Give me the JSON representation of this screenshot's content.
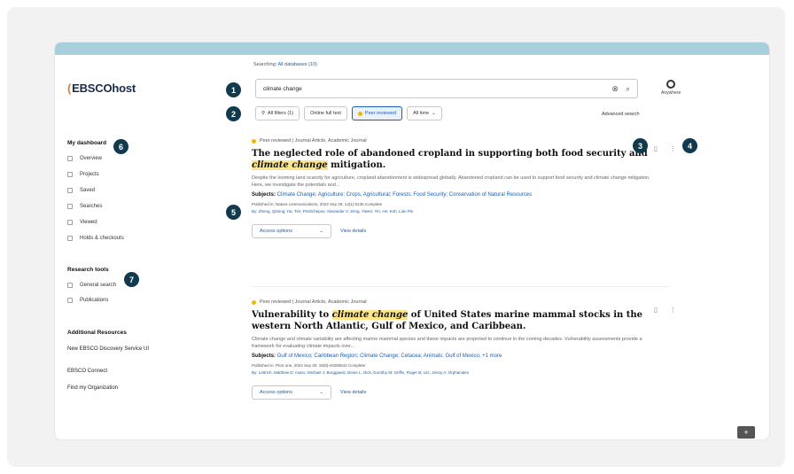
{
  "logo": {
    "text": "EBSCOhost",
    "mark": "("
  },
  "sidebar": {
    "dashboard_title": "My dashboard",
    "dashboard_items": [
      {
        "label": "Overview",
        "icon": "overview-icon"
      },
      {
        "label": "Projects",
        "icon": "projects-icon"
      },
      {
        "label": "Saved",
        "icon": "saved-icon"
      },
      {
        "label": "Searches",
        "icon": "searches-icon"
      },
      {
        "label": "Viewed",
        "icon": "viewed-icon"
      },
      {
        "label": "Holds & checkouts",
        "icon": "holds-icon"
      }
    ],
    "tools_title": "Research tools",
    "tools_items": [
      {
        "label": "General search",
        "icon": "search-icon"
      },
      {
        "label": "Publications",
        "icon": "publications-icon"
      }
    ],
    "resources_title": "Additional Resources",
    "resources": [
      "New EBSCO Discovery Service UI",
      "EBSCO Connect",
      "Find my Organization"
    ]
  },
  "search": {
    "searching_label": "Searching:",
    "searching_value": "All databases (10)",
    "query": "climate change",
    "profile_label": "Anywhere"
  },
  "filters": {
    "all_filters": "All filters (1)",
    "full_text": "Online full text",
    "peer_reviewed": "Peer reviewed",
    "all_time": "All time",
    "advanced": "Advanced search"
  },
  "results": [
    {
      "meta": "Peer reviewed | Journal Article, Academic Journal",
      "title_a": "The neglected role of abandoned cropland in supporting both food security and ",
      "title_hl": "climate change",
      "title_b": " mitigation.",
      "abstract": "Despite the looming land scarcity for agriculture, cropland abandonment is widespread globally. Abandoned cropland can be used to support food security and climate change mitigation. Here, we investigate the potentials and...",
      "subjects_label": "Subjects:",
      "subjects": "Climate Change; Agriculture; Crops, Agricultural; Forests; Food Security; Conservation of Natural Resources",
      "published": "Published in: Nature communications, 2023 Sep 26; 14(1):6136 Complete",
      "by": "By: Zheng, Qiming; Ha, Tim; Prishchepov, Alexander V; Zeng, Yiwen; Yin, He; Koh, Lian Pin",
      "access": "Access options",
      "details": "View details"
    },
    {
      "meta": "Peer reviewed | Journal Article, Academic Journal",
      "title_a": "Vulnerability to ",
      "title_hl": "climate change",
      "title_b": " of United States marine mammal stocks in the western North Atlantic, Gulf of Mexico, and Caribbean.",
      "abstract": "Climate change and climate variability are affecting marine mammal species and these impacts are projected to continue in the coming decades. Vulnerability assessments provide a framework for evaluating climate impacts over...",
      "subjects_label": "Subjects:",
      "subjects": "Gulf of Mexico; Caribbean Region; Climate Change; Cetacea; Animals; Gulf of Mexico; +1 more",
      "published": "Published in: PloS one, 2023 Sep 20; 18(9):e0290643 Complete",
      "by": "By: Lettrich, Matthew D; Asaro, Michael J; Borggaard, Diane L; Dick, Dorothy M; Griffis, Roger B; Litz, Jenny A; Orphanides",
      "access": "Access options",
      "details": "View details"
    }
  ],
  "callouts": [
    "1",
    "2",
    "3",
    "4",
    "5",
    "6",
    "7"
  ],
  "colors": {
    "accent": "#1a5fb4",
    "highlight": "#fde68a",
    "badge": "#123a4d",
    "topbar": "#a8cfdc",
    "peer_dot": "#f2b705"
  }
}
